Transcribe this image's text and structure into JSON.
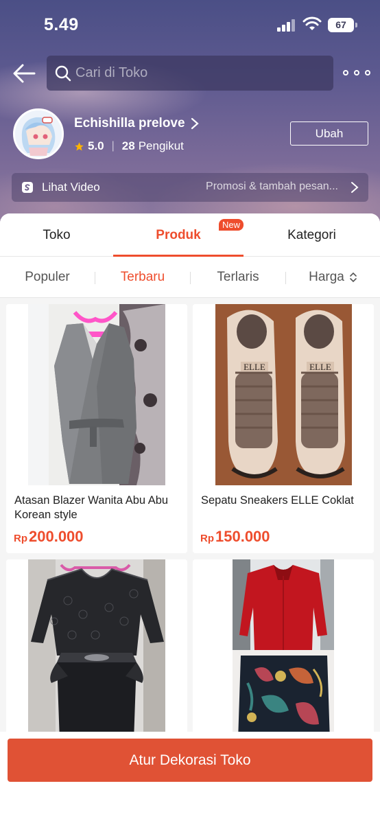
{
  "status": {
    "time": "5.49",
    "battery": "67"
  },
  "header": {
    "search_placeholder": "Cari di Toko"
  },
  "shop": {
    "name": "Echishilla prelove",
    "rating": "5.0",
    "followers_count": "28",
    "followers_label": "Pengikut",
    "edit_label": "Ubah"
  },
  "video_bar": {
    "label": "Lihat Video",
    "promo": "Promosi & tambah pesan..."
  },
  "tabs": [
    {
      "label": "Toko"
    },
    {
      "label": "Produk",
      "badge": "New"
    },
    {
      "label": "Kategori"
    }
  ],
  "sort": [
    {
      "label": "Populer"
    },
    {
      "label": "Terbaru"
    },
    {
      "label": "Terlaris"
    },
    {
      "label": "Harga"
    }
  ],
  "products": [
    {
      "title": "Atasan Blazer Wanita Abu Abu Korean style",
      "currency": "Rp",
      "price": "200.000"
    },
    {
      "title": "Sepatu Sneakers ELLE Coklat",
      "currency": "Rp",
      "price": "150.000"
    },
    {
      "title": "",
      "currency": "",
      "price": ""
    },
    {
      "title": "",
      "currency": "",
      "price": ""
    }
  ],
  "shoe_brand": "ELLE",
  "bottom_button": "Atur Dekorasi Toko",
  "colors": {
    "accent": "#ee4d2d",
    "button": "#e05235"
  }
}
